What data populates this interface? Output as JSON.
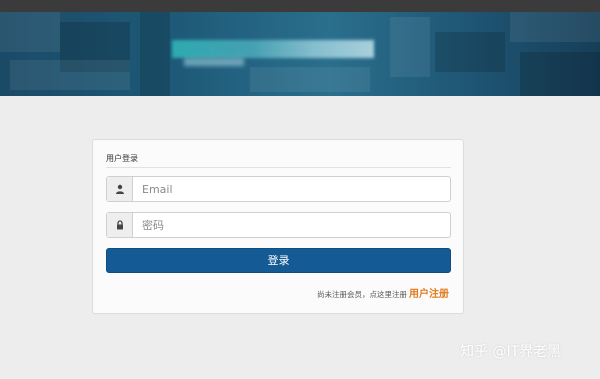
{
  "login": {
    "title": "用户登录",
    "email_placeholder": "Email",
    "password_placeholder": "密码",
    "submit_label": "登录",
    "register_prompt": "尚未注册会员，点这里注册",
    "register_link": "用户注册"
  },
  "watermark": {
    "text": "知乎 @IT界老黑"
  },
  "colors": {
    "primary_button": "#145a94",
    "register_link": "#e07b1e",
    "banner": "#1e5a78"
  },
  "icons": {
    "email_field": "user-icon",
    "password_field": "lock-icon"
  }
}
